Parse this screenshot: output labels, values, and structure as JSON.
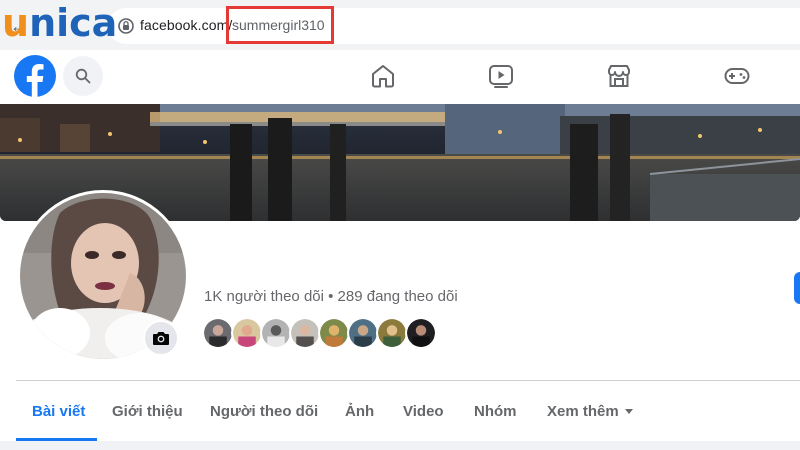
{
  "browser": {
    "url_domain": "facebook.com/",
    "url_path": "summergirl310",
    "back_glyph": "←"
  },
  "logo": {
    "first_letter": "u",
    "rest": "nica"
  },
  "profile": {
    "follow_stats": "1K người theo dõi • 289 đang theo dõi"
  },
  "tabs": [
    {
      "label": "Bài viết",
      "active": true
    },
    {
      "label": "Giới thiệu",
      "active": false
    },
    {
      "label": "Người theo dõi",
      "active": false
    },
    {
      "label": "Ảnh",
      "active": false
    },
    {
      "label": "Video",
      "active": false
    },
    {
      "label": "Nhóm",
      "active": false
    },
    {
      "label": "Xem thêm",
      "active": false
    }
  ],
  "nav_icons": [
    "home-icon",
    "watch-icon",
    "marketplace-icon",
    "gaming-icon"
  ],
  "colors": {
    "facebook_blue": "#1877f2",
    "highlight_red": "#e53935",
    "logo_orange": "#f18f1c",
    "logo_blue": "#1e63b8"
  }
}
